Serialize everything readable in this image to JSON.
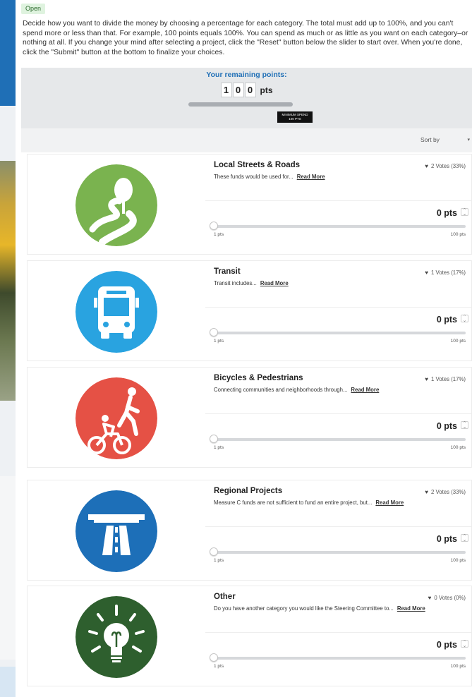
{
  "status": "Open",
  "instructions": "Decide how you want to divide the money by choosing a percentage for each category. The total must add up to 100%, and you can't spend more or less than that. For example, 100 points equals 100%. You can spend as much or as little as you want on each category–or nothing at all. If you change your mind after selecting a project, click the \"Reset\" button below the slider to start over. When you're done, click the \"Submit\" button at the bottom to finalize your choices.",
  "points": {
    "title": "Your remaining points:",
    "digits": [
      "1",
      "0",
      "0"
    ],
    "unit": "pts",
    "min_label": "MINIMUM SPEND",
    "min_value": "100 PTS"
  },
  "sort_label": "Sort by",
  "colors": {
    "accent": "#1f6fb6",
    "streets": "#7ab34f",
    "transit": "#29a3e0",
    "bikes": "#e55145",
    "regional": "#1d6fb8",
    "other": "#2e5f2e"
  },
  "categories": [
    {
      "title": "Local Streets & Roads",
      "desc": "These funds would be used for...",
      "read_more": "Read More",
      "votes": "2 Votes (33%)",
      "pts": "0 pts",
      "min": "1 pts",
      "max": "100 pts",
      "icon": "road-tree-icon"
    },
    {
      "title": "Transit",
      "desc": "Transit includes...",
      "read_more": "Read More",
      "votes": "1 Votes (17%)",
      "pts": "0 pts",
      "min": "1 pts",
      "max": "100 pts",
      "icon": "bus-icon"
    },
    {
      "title": "Bicycles & Pedestrians",
      "desc": "Connecting communities and neighborhoods through...",
      "read_more": "Read More",
      "votes": "1 Votes (17%)",
      "pts": "0 pts",
      "min": "1 pts",
      "max": "100 pts",
      "icon": "bike-pedestrian-icon"
    },
    {
      "title": "Regional Projects",
      "desc": "Measure C funds are not sufficient to fund an entire project, but...",
      "read_more": "Read More",
      "votes": "2 Votes (33%)",
      "pts": "0 pts",
      "min": "1 pts",
      "max": "100 pts",
      "icon": "highway-icon"
    },
    {
      "title": "Other",
      "desc": "Do you have another category you would like the Steering Committee to...",
      "read_more": "Read More",
      "votes": "0 Votes (0%)",
      "pts": "0 pts",
      "min": "1 pts",
      "max": "100 pts",
      "icon": "lightbulb-icon"
    }
  ]
}
